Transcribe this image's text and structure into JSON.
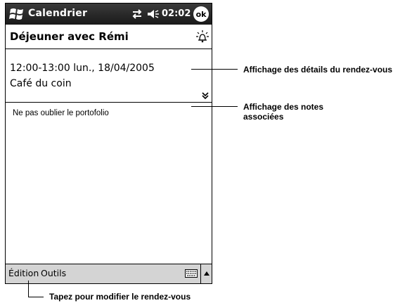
{
  "titlebar": {
    "app_title": "Calendrier",
    "clock": "02:02",
    "ok_label": "ok"
  },
  "appointment": {
    "subject": "Déjeuner avec Rémi",
    "time": "12:00-13:00 lun., 18/04/2005",
    "location": "Café du coin",
    "notes": "Ne pas oublier le portofolio"
  },
  "menubar": {
    "items": [
      "Édition",
      "Outils"
    ]
  },
  "callouts": {
    "details": "Affichage des détails du rendez-vous",
    "notes_line1": "Affichage des notes",
    "notes_line2": "associées",
    "edit": "Tapez pour modifier le rendez-vous"
  },
  "colors": {
    "titlebar": "#222222",
    "menubar": "#d4d4d4"
  }
}
